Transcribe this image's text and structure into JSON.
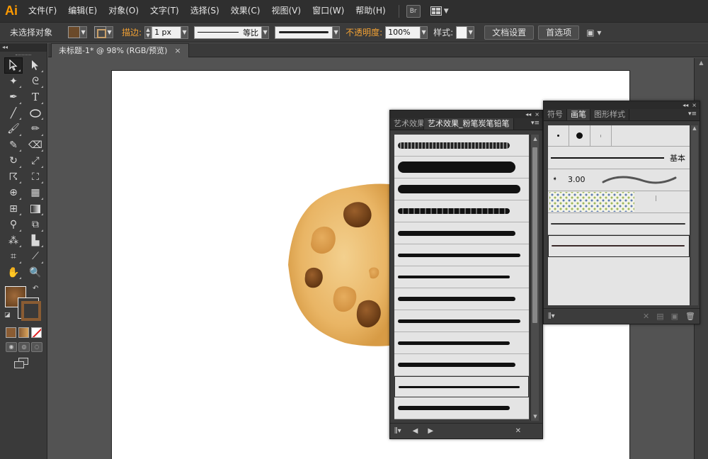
{
  "app": {
    "logo": "Ai"
  },
  "menu": {
    "items": [
      "文件(F)",
      "编辑(E)",
      "对象(O)",
      "文字(T)",
      "选择(S)",
      "效果(C)",
      "视图(V)",
      "窗口(W)",
      "帮助(H)"
    ],
    "bridge_label": "Br"
  },
  "control_bar": {
    "selection_status": "未选择对象",
    "stroke_label": "描边:",
    "stroke_weight": "1 px",
    "profile_label": "等比",
    "opacity_label": "不透明度:",
    "opacity_value": "100%",
    "style_label": "样式:",
    "doc_setup_button": "文档设置",
    "preferences_button": "首选项"
  },
  "document": {
    "tab_title": "未标题-1* @ 98% (RGB/预览)",
    "tab_close": "×"
  },
  "panels": {
    "charcoal": {
      "tabs": [
        "艺术效果",
        "艺术效果_粉笔炭笔铅笔"
      ],
      "active_tab": 1,
      "collapse_glyph": "◂◂",
      "close_glyph": "×",
      "selected_index": 11,
      "brush_count": 13
    },
    "brushes": {
      "tabs": [
        "符号",
        "画笔",
        "图形样式"
      ],
      "active_tab": 1,
      "collapse_glyph": "◂◂",
      "close_glyph": "×",
      "basic_label": "基本",
      "art_brush_weight": "3.00"
    }
  },
  "colors": {
    "accent_orange": "#f2a134",
    "fill_swatch": "#6b4a2a",
    "cookie_dough": "#e8b766",
    "chocolate_chip": "#6e3f17"
  }
}
